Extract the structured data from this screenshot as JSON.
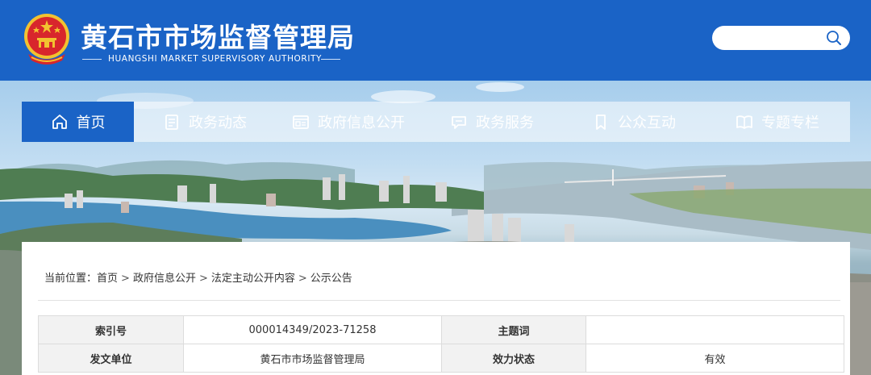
{
  "header": {
    "title": "黄石市市场监督管理局",
    "subtitle": "HUANGSHI MARKET SUPERVISORY AUTHORITY",
    "search_placeholder": ""
  },
  "nav": {
    "items": [
      {
        "label": "首页",
        "icon": "home-icon",
        "active": true
      },
      {
        "label": "政务动态",
        "icon": "news-icon",
        "active": false
      },
      {
        "label": "政府信息公开",
        "icon": "info-disclosure-icon",
        "active": false
      },
      {
        "label": "政务服务",
        "icon": "service-chat-icon",
        "active": false
      },
      {
        "label": "公众互动",
        "icon": "bookmark-icon",
        "active": false
      },
      {
        "label": "专题专栏",
        "icon": "book-icon",
        "active": false
      }
    ]
  },
  "breadcrumb": {
    "prefix": "当前位置：",
    "items": [
      "首页",
      "政府信息公开",
      "法定主动公开内容",
      "公示公告"
    ],
    "separator": ">"
  },
  "meta_table": {
    "rows": [
      {
        "k1": "索引号",
        "v1": "000014349/2023-71258",
        "k2": "主题词",
        "v2": ""
      },
      {
        "k1": "发文单位",
        "v1": "黄石市市场监督管理局",
        "k2": "效力状态",
        "v2": "有效"
      }
    ]
  },
  "colors": {
    "brand_blue": "#1a63c6",
    "emblem_red": "#d8262c",
    "emblem_gold": "#f2c230"
  }
}
